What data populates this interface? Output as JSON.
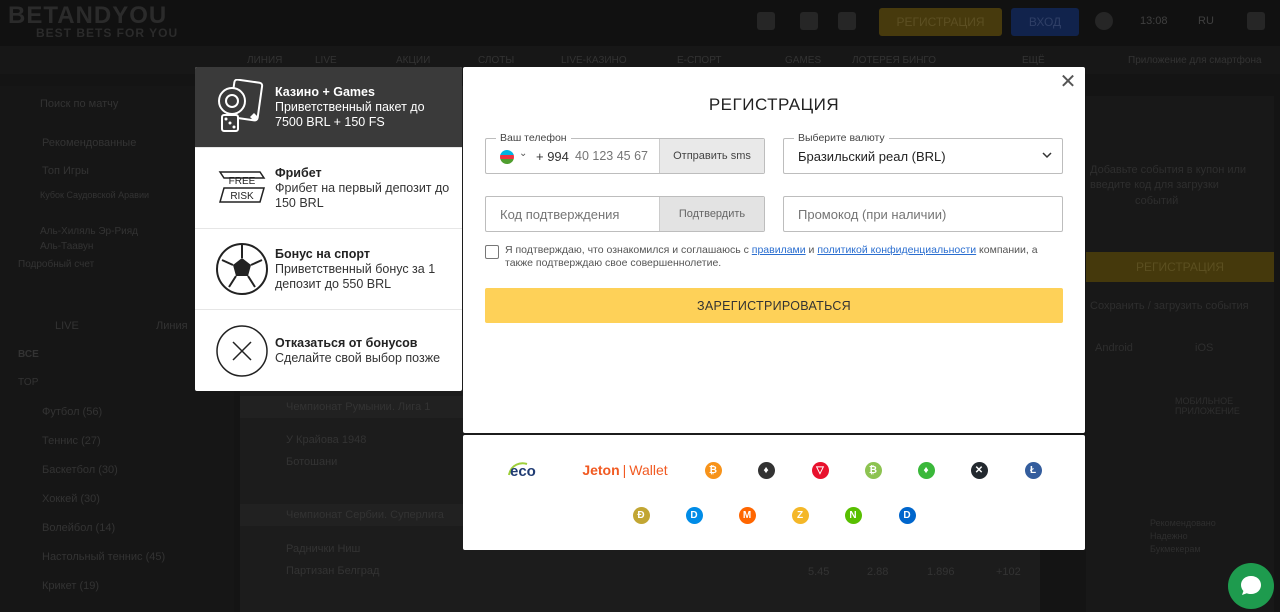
{
  "background": {
    "logo": "BETANDYOU",
    "logo_sub": "BEST BETS FOR YOU",
    "register_label": "РЕГИСТРАЦИЯ",
    "login_label": "ВХОД",
    "time": "13:08",
    "lang": "RU",
    "nav": [
      "ЛИНИЯ",
      "LIVE",
      "АКЦИИ",
      "СЛОТЫ",
      "LIVE-КАЗИНО",
      "Е-СПОРТ",
      "GAMES",
      "ЛОТЕРЕЯ БИНГО",
      "ЕЩЁ"
    ],
    "app_label": "Приложение для смартфона",
    "sidebar": {
      "search": "Поиск по матчу",
      "recommended": "Рекомендованные",
      "top_games": "Топ Игры",
      "match_title": "Кубок Саудовской Аравии",
      "team1": "Аль-Хиляль Эр-Рияд",
      "team2": "Аль-Таавун",
      "detail": "Подробный счет",
      "live_tab": "LIVE",
      "line_tab": "Линия",
      "all": "ВСЕ",
      "top": "TOP",
      "sports": [
        "Футбол (56)",
        "Теннис (27)",
        "Баскетбол (30)",
        "Хоккей (30)",
        "Волейбол (14)",
        "Настольный теннис (45)",
        "Крикет (19)"
      ]
    },
    "matches": [
      {
        "league": "Чемпионат Румынии. Лига 1"
      },
      {
        "team": "У Крайова 1948"
      },
      {
        "team": "Ботошани"
      },
      {
        "league": "Чемпионат Сербии. Суперлига"
      },
      {
        "team": "Раднички Ниш"
      },
      {
        "team": "Партизан Белград"
      }
    ],
    "odds": [
      "5.45",
      "2.88",
      "1.896",
      "+102"
    ],
    "right": {
      "placeholder1": "Добавьте события в купон или",
      "placeholder2": "введите код для загрузки",
      "placeholder3": "событий",
      "register_label": "РЕГИСТРАЦИЯ",
      "save_label": "Сохранить / загрузить события",
      "android": "Android",
      "ios": "iOS",
      "app_title": "МОБИЛЬНОЕ ПРИЛОЖЕНИЕ",
      "promo1": "Рекомендовано",
      "promo2": "Надежно",
      "promo3": "Букмекерам"
    }
  },
  "bonuses": [
    {
      "title": "Казино + Games",
      "desc": "Приветственный пакет до 7500 BRL + 150 FS",
      "icon": "casino-games-icon",
      "active": true
    },
    {
      "title": "Фрибет",
      "desc": "Фрибет на первый депозит до 150 BRL",
      "icon": "freebet-icon",
      "active": false,
      "icon_text1": "FREE",
      "icon_text2": "RISK"
    },
    {
      "title": "Бонус на спорт",
      "desc": "Приветственный бонус за 1 депозит до 550 BRL",
      "icon": "soccer-ball-icon",
      "active": false
    },
    {
      "title": "Отказаться от бонусов",
      "desc": "Сделайте свой выбор позже",
      "icon": "cancel-x-icon",
      "active": false
    }
  ],
  "modal": {
    "title": "РЕГИСТРАЦИЯ",
    "phone_label": "Ваш телефон",
    "phone_code": "+ 994",
    "phone_placeholder": "40 123 45 67",
    "send_sms": "Отправить sms",
    "currency_label": "Выберите валюту",
    "currency_value": "Бразильский реал (BRL)",
    "code_placeholder": "Код подтверждения",
    "confirm": "Подтвердить",
    "promo_placeholder": "Промокод (при наличии)",
    "agree_part1": "Я подтверждаю, что ознакомился и соглашаюсь с ",
    "agree_link1": "правилами",
    "agree_and": " и ",
    "agree_link2": "политикой конфиденциальности",
    "agree_part2": " компании, а также подтверждаю свое совершеннолетие.",
    "submit": "ЗАРЕГИСТРИРОВАТЬСЯ"
  },
  "payments": {
    "eco": "eco",
    "jeton": "Jeton",
    "wallet": "Wallet",
    "coins": [
      {
        "name": "bitcoin-icon",
        "symbol": "₿",
        "color": "#f7931a"
      },
      {
        "name": "ethereum-icon",
        "symbol": "♦",
        "color": "#333333"
      },
      {
        "name": "tron-icon",
        "symbol": "▽",
        "color": "#e8112d"
      },
      {
        "name": "bitcoin-cash-icon",
        "symbol": "₿",
        "color": "#8dc351"
      },
      {
        "name": "ethereum-classic-icon",
        "symbol": "♦",
        "color": "#3ab83a"
      },
      {
        "name": "ripple-icon",
        "symbol": "✕",
        "color": "#23292f"
      },
      {
        "name": "litecoin-icon",
        "symbol": "Ł",
        "color": "#345d9d"
      },
      {
        "name": "dogecoin-icon",
        "symbol": "Ð",
        "color": "#c2a633"
      },
      {
        "name": "dash-icon",
        "symbol": "D",
        "color": "#008ce7"
      },
      {
        "name": "monero-icon",
        "symbol": "M",
        "color": "#ff6600"
      },
      {
        "name": "zcash-icon",
        "symbol": "Z",
        "color": "#f4b728"
      },
      {
        "name": "neo-icon",
        "symbol": "N",
        "color": "#58bf00"
      },
      {
        "name": "digibyte-icon",
        "symbol": "D",
        "color": "#0066cc"
      }
    ]
  }
}
